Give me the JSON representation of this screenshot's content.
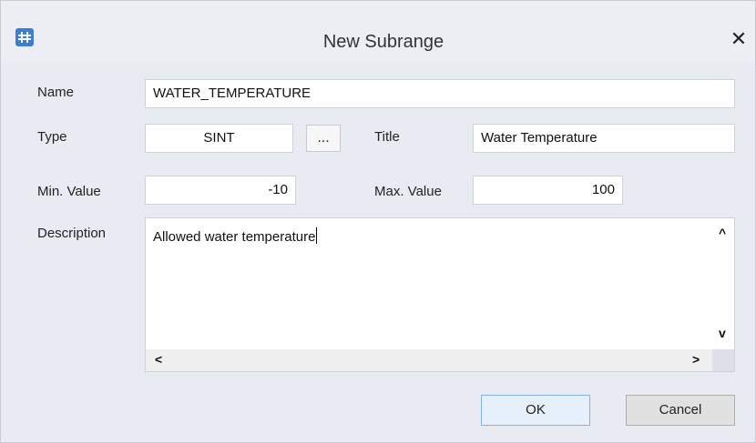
{
  "dialog": {
    "title": "New Subrange",
    "close_glyph": "✕",
    "icon": "app-grid-icon"
  },
  "form": {
    "name_label": "Name",
    "name_value": "WATER_TEMPERATURE",
    "type_label": "Type",
    "type_value": "SINT",
    "browse_label": "...",
    "title_label": "Title",
    "title_value": "Water Temperature",
    "min_label": "Min. Value",
    "min_value": "-10",
    "max_label": "Max. Value",
    "max_value": "100",
    "description_label": "Description",
    "description_value": "Allowed water temperature"
  },
  "scroll": {
    "up": "^",
    "down": "v",
    "left": "<",
    "right": ">"
  },
  "buttons": {
    "ok": "OK",
    "cancel": "Cancel"
  }
}
